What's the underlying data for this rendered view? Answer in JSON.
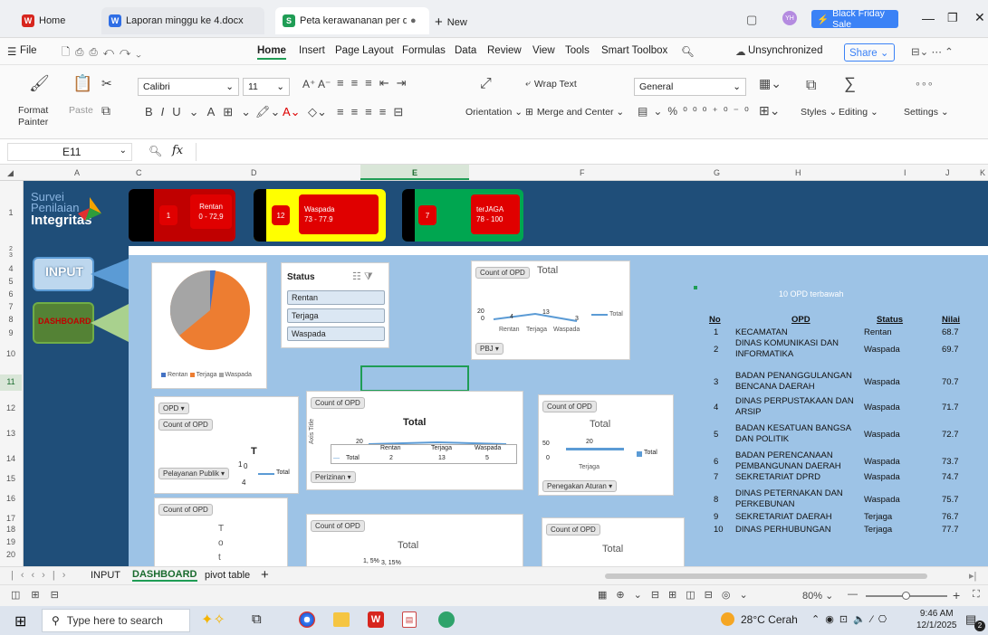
{
  "browser_tabs": [
    {
      "label": "Home",
      "icon": "W",
      "color": "#d7261e"
    },
    {
      "label": "Laporan minggu ke 4.docx",
      "icon": "W",
      "color": "#2f6ee5"
    },
    {
      "label": "Peta kerawananan per dimens",
      "icon": "S",
      "color": "#1f9d55"
    }
  ],
  "new_tab": "New",
  "black_friday": "Black Friday Sale",
  "menu": {
    "file": "File",
    "items": [
      "Home",
      "Insert",
      "Page Layout",
      "Formulas",
      "Data",
      "Review",
      "View",
      "Tools",
      "Smart Toolbox"
    ],
    "unsync": "Unsynchronized",
    "share": "Share"
  },
  "ribbon": {
    "format_painter": "Format Painter",
    "paste": "Paste",
    "font": "Calibri",
    "size": "11",
    "wrap": "Wrap Text",
    "orientation": "Orientation",
    "merge": "Merge and Center",
    "number_format": "General",
    "styles": "Styles",
    "editing": "Editing",
    "settings": "Settings"
  },
  "formula": {
    "cell": "E11",
    "fx": "fx"
  },
  "columns": [
    "A",
    "C",
    "D",
    "E",
    "F",
    "G",
    "H",
    "I",
    "J",
    "K"
  ],
  "rows": [
    "1",
    "2",
    "3",
    "4",
    "5",
    "6",
    "7",
    "8",
    "9",
    "10",
    "11",
    "12",
    "13",
    "14",
    "15",
    "16",
    "17",
    "18",
    "19",
    "20"
  ],
  "logo": {
    "line1": "Survei",
    "line2": "Penilaian",
    "line3": "Integritas"
  },
  "legend": [
    {
      "count": "1",
      "label": "Rentan",
      "range": "0 - 72,9"
    },
    {
      "count": "12",
      "label": "Waspada",
      "range": "73 - 77.9"
    },
    {
      "count": "7",
      "label": "terJAGA",
      "range": "78 - 100"
    }
  ],
  "nav": {
    "input": "INPUT",
    "dashboard": "DASHBOARD"
  },
  "pie": {
    "legend": [
      "Rentan",
      "Terjaga",
      "Waspada"
    ]
  },
  "slicer": {
    "title": "Status",
    "items": [
      "Rentan",
      "Terjaga",
      "Waspada"
    ]
  },
  "chart_top": {
    "field": "Count of OPD",
    "title": "Total",
    "values": [
      "4",
      "13",
      "3"
    ],
    "cats": [
      "Rentan",
      "Terjaga",
      "Waspada"
    ],
    "axis": [
      "20",
      "0"
    ],
    "series": "Total",
    "filter": "PBJ"
  },
  "chart_left": {
    "filter": "OPD",
    "field": "Count of OPD",
    "title_partial": "T",
    "values": [
      "1",
      "0"
    ],
    "cat": "Pelayanan Publik",
    "val": "4",
    "series": "Total"
  },
  "chart_mid": {
    "field": "Count of OPD",
    "title": "Total",
    "axis_title": "Axis Title",
    "axis": "20",
    "cats": [
      "Rentan",
      "Terjaga",
      "Waspada"
    ],
    "values": [
      "2",
      "13",
      "5"
    ],
    "row_label": "Total",
    "filter": "Perizinan"
  },
  "chart_right": {
    "field": "Count of OPD",
    "title": "Total",
    "axis": [
      "50",
      "0"
    ],
    "value": "20",
    "cat": "Terjaga",
    "series": "Total",
    "filter": "Penegakan Aturan"
  },
  "chart_b1": {
    "field": "Count of OPD",
    "vertical": [
      "T",
      "o",
      "t"
    ]
  },
  "chart_b2": {
    "field": "Count of OPD",
    "title": "Total",
    "labels": [
      "1, 5%",
      "3, 15%"
    ]
  },
  "chart_b3": {
    "field": "Count of OPD",
    "title": "Total"
  },
  "opd_table": {
    "title": "10 OPD terbawah",
    "headers": [
      "No",
      "OPD",
      "Status",
      "Nilai"
    ],
    "rows": [
      [
        "1",
        "KECAMATAN",
        "Rentan",
        "68.7"
      ],
      [
        "2",
        "DINAS KOMUNIKASI DAN INFORMATIKA",
        "Waspada",
        "69.7"
      ],
      [
        "3",
        "BADAN PENANGGULANGAN BENCANA DAERAH",
        "Waspada",
        "70.7"
      ],
      [
        "4",
        "DINAS PERPUSTAKAAN DAN ARSIP",
        "Waspada",
        "71.7"
      ],
      [
        "5",
        "BADAN KESATUAN BANGSA DAN POLITIK",
        "Waspada",
        "72.7"
      ],
      [
        "6",
        "BADAN PERENCANAAN PEMBANGUNAN DAERAH",
        "Waspada",
        "73.7"
      ],
      [
        "7",
        "SEKRETARIAT DPRD",
        "Waspada",
        "74.7"
      ],
      [
        "8",
        "DINAS PETERNAKAN DAN PERKEBUNAN",
        "Waspada",
        "75.7"
      ],
      [
        "9",
        "SEKRETARIAT DAERAH",
        "Terjaga",
        "76.7"
      ],
      [
        "10",
        "DINAS PERHUBUNGAN",
        "Terjaga",
        "77.7"
      ]
    ]
  },
  "sheets": [
    "INPUT",
    "DASHBOARD",
    "pivot table"
  ],
  "zoom": "80%",
  "taskbar": {
    "search": "Type here to search",
    "weather": "28°C Cerah",
    "time": "9:46 AM",
    "date": "12/1/2025",
    "notif": "2"
  }
}
